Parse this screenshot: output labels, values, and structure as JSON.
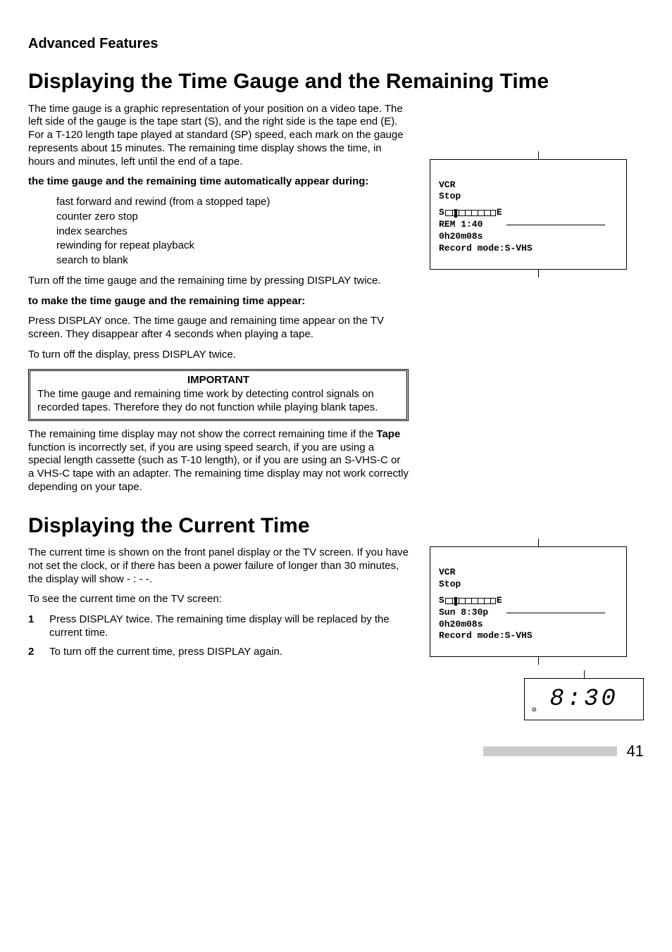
{
  "sectionLabel": "Advanced Features",
  "heading1": "Displaying the Time Gauge and the Remaining Time",
  "para1": "The time gauge is a graphic representation of your position on a video tape.  The left side of the gauge is the tape start (S), and the right side is the tape end (E).  For a T-120 length tape played at standard (SP) speed, each mark on the gauge represents about 15 minutes.  The remaining time display shows the time, in hours and minutes, left until the end of a tape.",
  "autoAppearLabel": "the time gauge and the remaining time automatically appear during:",
  "autoList": [
    "fast forward and rewind (from a stopped tape)",
    "counter zero stop",
    "index searches",
    "rewinding for repeat playback",
    "search to blank"
  ],
  "para2": "Turn off the time gauge and the remaining time by pressing DISPLAY twice.",
  "makeAppearLabel": "to make the time gauge and the remaining time appear:",
  "para3": "Press DISPLAY once.  The time gauge and remaining time appear on the TV screen.  They disappear after 4 seconds when playing a tape.",
  "para4": "To turn off the display, press DISPLAY twice.",
  "importantTitle": "IMPORTANT",
  "importantBody": "The time gauge and remaining time work by detecting control signals on recorded tapes.  Therefore they do not function while playing blank tapes.",
  "para5a": "The remaining time display may not show the correct remaining time if the ",
  "para5bold": "Tape",
  "para5b": " function is incorrectly set, if you are using speed search, if you are using a special length cassette (such as T-10 length), or if you are using an S-VHS-C or a VHS-C tape with an adapter. The remaining time display may not work correctly depending on your tape.",
  "heading2": "Displaying the Current Time",
  "para6": "The current time is shown on the front panel display or the TV screen.  If you have not set the clock, or if there has been a power failure of longer than 30 minutes, the display will show - : - -.",
  "para7": "To see the current time on the TV screen:",
  "steps": [
    {
      "num": "1",
      "text": "Press DISPLAY twice.  The remaining time display will be replaced by the current time."
    },
    {
      "num": "2",
      "text": "To turn off the current time, press DISPLAY again."
    }
  ],
  "osd1": {
    "line1": "VCR",
    "line2": "Stop",
    "gaugeS": "S",
    "gaugeE": "E",
    "rem": " REM  1:40",
    "counter": "  0h20m08s",
    "recmode": "Record mode:S-VHS"
  },
  "osd2": {
    "line1": "VCR",
    "line2": "Stop",
    "gaugeS": "S",
    "gaugeE": "E",
    "rem": "Sun  8:30p",
    "counter": "  0h20m08s",
    "recmode": "Record mode:S-VHS"
  },
  "lcdTime": "8:30",
  "lcdRec": "⊙",
  "pageNum": "41"
}
